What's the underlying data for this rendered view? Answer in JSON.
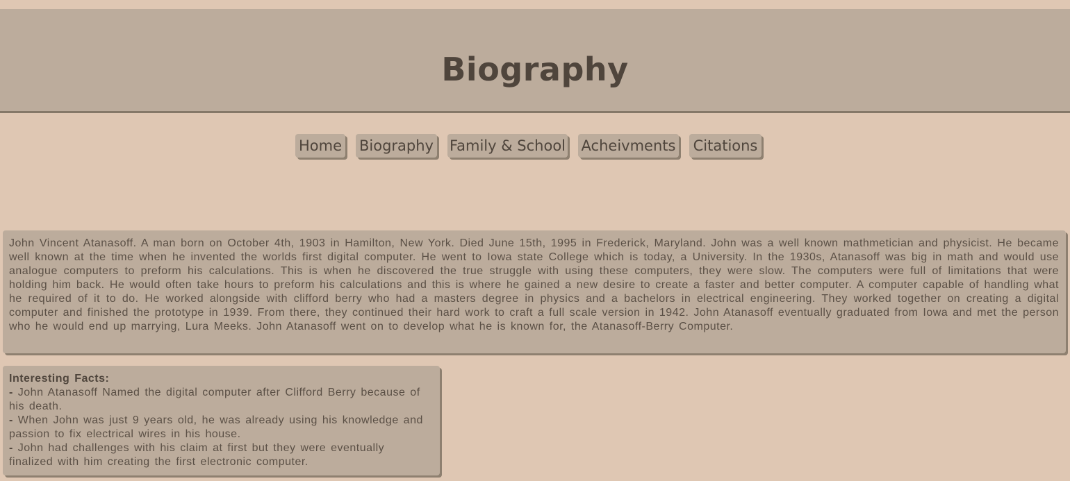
{
  "header": {
    "title": "Biography"
  },
  "nav": {
    "items": [
      {
        "label": "Home"
      },
      {
        "label": "Biography"
      },
      {
        "label": "Family & School"
      },
      {
        "label": "Acheivments"
      },
      {
        "label": "Citations"
      }
    ]
  },
  "biography": {
    "text": "John Vincent Atanasoff. A man born on October 4th, 1903 in Hamilton, New York. Died June 15th, 1995 in Frederick, Maryland. John was a well known mathmetician and physicist. He became well known at the time when he invented the worlds first digital computer. He went to Iowa state College which is today, a University. In the 1930s, Atanasoff was big in math and would use analogue computers to preform his calculations. This is when he discovered the true struggle with using these computers, they were slow. The computers were full of limitations that were holding him back. He would often take hours to preform his calculations and this is where he gained a new desire to create a faster and better computer. A computer capable of handling what he required of it to do. He worked alongside with clifford berry who had a masters degree in physics and a bachelors in electrical engineering. They worked together on creating a digital computer and finished the prototype in 1939. From there, they continued their hard work to craft a full scale version in 1942. John Atanasoff eventually graduated from Iowa and met the person who he would end up marrying, Lura Meeks. John Atanasoff went on to develop what he is known for, the Atanasoff-Berry Computer."
  },
  "facts": {
    "heading": "Interesting Facts:",
    "dash": "-",
    "items": [
      "John Atanasoff Named the digital computer after Clifford Berry because of his death.",
      "When John was just 9 years old, he was already using his knowledge and passion to fix electrical wires in his house.",
      "John had challenges with his claim at first but they were eventually finalized with him creating the first electronic computer."
    ]
  }
}
